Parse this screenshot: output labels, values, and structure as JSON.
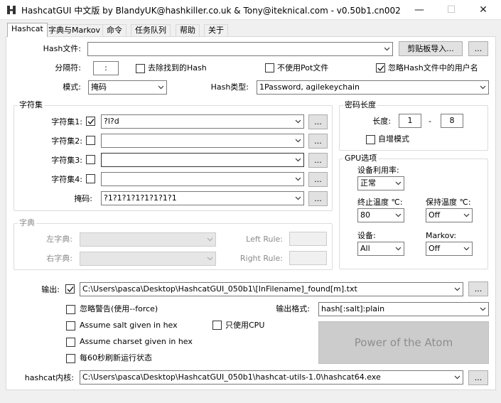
{
  "window": {
    "title": "HashcatGUI 中文版 by BlandyUK@hashkiller.co.uk & Tony@iteknical.com - v0.50b1.cn002",
    "minimize": "—",
    "maximize": "☐",
    "close": "✕"
  },
  "tabs": [
    "Hashcat",
    "字典与Markov",
    "命令",
    "任务队列",
    "帮助",
    "关于"
  ],
  "top": {
    "hash_file_label": "Hash文件:",
    "hash_file_value": "",
    "paste_import_label": "剪贴板导入...",
    "browse_label": "...",
    "separator_label": "分隔符:",
    "separator_value": ":",
    "remove_found_label": "去除找到的Hash",
    "remove_found_checked": false,
    "no_potfile_label": "不使用Pot文件",
    "no_potfile_checked": false,
    "ignore_username_label": "忽略Hash文件中的用户名",
    "ignore_username_checked": true,
    "mode_label": "模式:",
    "mode_value": "掩码",
    "hash_type_label": "Hash类型:",
    "hash_type_value": "1Password, agilekeychain"
  },
  "charset": {
    "group_title": "字符集",
    "rows": [
      {
        "label": "字符集1:",
        "checked": true,
        "value": "?l?d",
        "btn": "..."
      },
      {
        "label": "字符集2:",
        "checked": false,
        "value": "",
        "btn": "..."
      },
      {
        "label": "字符集3:",
        "checked": false,
        "value": "",
        "btn": "..."
      },
      {
        "label": "字符集4:",
        "checked": false,
        "value": "",
        "btn": "..."
      }
    ],
    "mask_label": "掩码:",
    "mask_value": "?1?1?1?1?1?1?1?1",
    "mask_btn": "..."
  },
  "pwlen": {
    "group_title": "密码长度",
    "length_label": "长度:",
    "min": "1",
    "dash": "-",
    "max": "8",
    "increment_label": "自增模式",
    "increment_checked": false
  },
  "gpu": {
    "group_title": "GPU选项",
    "util_label": "设备利用率:",
    "util_value": "正常",
    "abort_temp_label": "终止温度 ℃:",
    "abort_temp_value": "80",
    "retain_temp_label": "保持温度 ℃:",
    "retain_temp_value": "Off",
    "device_label": "设备:",
    "device_value": "All",
    "markov_label": "Markov:",
    "markov_value": "Off"
  },
  "dict": {
    "group_title": "字典",
    "left_label": "左字典:",
    "right_label": "右字典:",
    "left_rule_label": "Left Rule:",
    "right_rule_label": "Right Rule:"
  },
  "output": {
    "label": "输出:",
    "checked": true,
    "value": "C:\\Users\\pasca\\Desktop\\HashcatGUI_050b1\\[InFilename]_found[m].txt",
    "btn": "...",
    "ignore_warnings_label": "忽略警告(使用--force)",
    "ignore_warnings_checked": false,
    "format_label": "输出格式:",
    "format_value": "hash[:salt]:plain",
    "salt_hex_label": "Assume salt given in hex",
    "salt_hex_checked": false,
    "cpu_only_label": "只使用CPU",
    "cpu_only_checked": false,
    "charset_hex_label": "Assume charset given in hex",
    "charset_hex_checked": false,
    "status_label": "每60秒刷新运行状态",
    "status_checked": false,
    "power_button_label": "Power of the Atom",
    "core_label": "hashcat内核:",
    "core_value": "C:\\Users\\pasca\\Desktop\\HashcatGUI_050b1\\hashcat-utils-1.0\\hashcat64.exe",
    "core_btn": "..."
  }
}
